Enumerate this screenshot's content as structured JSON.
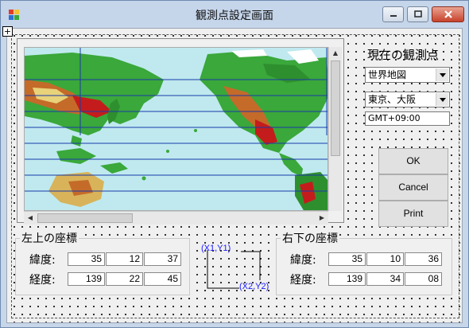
{
  "window": {
    "title": "観測点設定画面"
  },
  "side": {
    "title": "現在の観測点",
    "map_combo": "世界地図",
    "place_combo": "東京、大阪",
    "timezone": "GMT+09:00"
  },
  "buttons": {
    "ok": "OK",
    "cancel": "Cancel",
    "print": "Print"
  },
  "top_left": {
    "title": "左上の座標",
    "lat_label": "緯度:",
    "lat": [
      "35",
      "12",
      "37"
    ],
    "lon_label": "経度:",
    "lon": [
      "139",
      "22",
      "45"
    ]
  },
  "bottom_right": {
    "title": "右下の座標",
    "lat_label": "緯度:",
    "lat": [
      "35",
      "10",
      "36"
    ],
    "lon_label": "経度:",
    "lon": [
      "139",
      "34",
      "08"
    ]
  },
  "diagram": {
    "p1": "(X1,Y1)",
    "p2": "(X2,Y2)"
  },
  "icons": {
    "app": "app-icon",
    "minimize": "minimize-icon",
    "maximize": "maximize-icon",
    "close": "close-icon",
    "move": "move-handle-icon",
    "dropdown": "chevron-down-icon"
  },
  "colors": {
    "ocean": "#bfe9ef",
    "diagram_text": "#1a1aff",
    "grid_line": "#1a3aa8"
  }
}
